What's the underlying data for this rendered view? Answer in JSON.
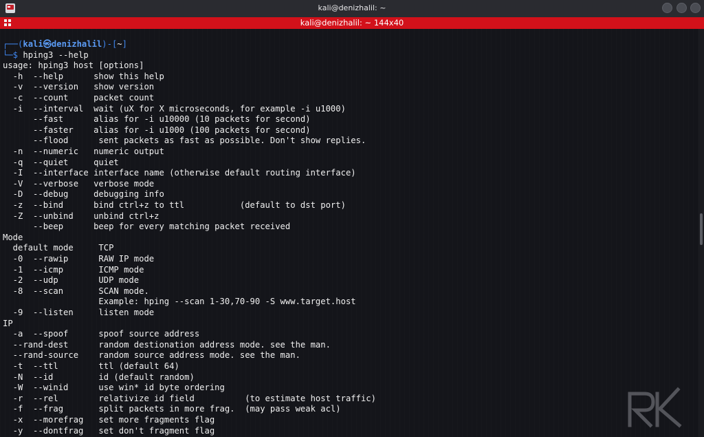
{
  "window": {
    "title": "kali@denizhalil: ~",
    "tab_title": "kali@denizhalil: ~ 144x40"
  },
  "prompt": {
    "line1_open": "┌──(",
    "user_host": "kali㉿denizhalil",
    "line1_mid": ")-[",
    "cwd": "~",
    "line1_close": "]",
    "line2_prefix": "└─$",
    "command": "hping3 --help"
  },
  "output": [
    "usage: hping3 host [options]",
    "  -h  --help      show this help",
    "  -v  --version   show version",
    "  -c  --count     packet count",
    "  -i  --interval  wait (uX for X microseconds, for example -i u1000)",
    "      --fast      alias for -i u10000 (10 packets for second)",
    "      --faster    alias for -i u1000 (100 packets for second)",
    "      --flood      sent packets as fast as possible. Don't show replies.",
    "  -n  --numeric   numeric output",
    "  -q  --quiet     quiet",
    "  -I  --interface interface name (otherwise default routing interface)",
    "  -V  --verbose   verbose mode",
    "  -D  --debug     debugging info",
    "  -z  --bind      bind ctrl+z to ttl           (default to dst port)",
    "  -Z  --unbind    unbind ctrl+z",
    "      --beep      beep for every matching packet received",
    "Mode",
    "  default mode     TCP",
    "  -0  --rawip      RAW IP mode",
    "  -1  --icmp       ICMP mode",
    "  -2  --udp        UDP mode",
    "  -8  --scan       SCAN mode.",
    "                   Example: hping --scan 1-30,70-90 -S www.target.host",
    "  -9  --listen     listen mode",
    "IP",
    "  -a  --spoof      spoof source address",
    "  --rand-dest      random destionation address mode. see the man.",
    "  --rand-source    random source address mode. see the man.",
    "  -t  --ttl        ttl (default 64)",
    "  -N  --id         id (default random)",
    "  -W  --winid      use win* id byte ordering",
    "  -r  --rel        relativize id field          (to estimate host traffic)",
    "  -f  --frag       split packets in more frag.  (may pass weak acl)",
    "  -x  --morefrag   set more fragments flag",
    "  -y  --dontfrag   set don't fragment flag"
  ],
  "icons": {
    "app": "kali-terminal-icon",
    "tab": "terminal-grid-icon",
    "watermark": "rk-logo"
  },
  "colors": {
    "tab_bar": "#d2111a",
    "prompt_blue": "#3f86ee",
    "background": "#14151a",
    "text": "#f0f0f0"
  }
}
